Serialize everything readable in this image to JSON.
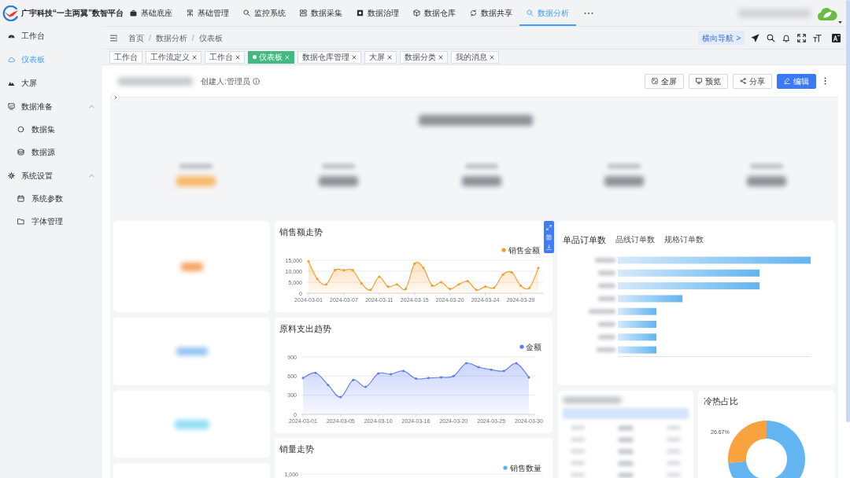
{
  "header": {
    "logo_text": "广宇科技“一主两翼”数智平台",
    "nav": [
      {
        "label": "基础底座",
        "selected": false
      },
      {
        "label": "基础管理",
        "selected": false
      },
      {
        "label": "监控系统",
        "selected": false
      },
      {
        "label": "数据采集",
        "selected": false
      },
      {
        "label": "数据治理",
        "selected": false
      },
      {
        "label": "数据仓库",
        "selected": false
      },
      {
        "label": "数据共享",
        "selected": false
      },
      {
        "label": "数据分析",
        "selected": true
      }
    ]
  },
  "sidebar": {
    "items": [
      {
        "label": "工作台",
        "selected": false
      },
      {
        "label": "仪表板",
        "selected": true
      },
      {
        "label": "大屏",
        "selected": false
      },
      {
        "label": "数据准备",
        "selected": false,
        "expanded": true,
        "children": [
          {
            "label": "数据集",
            "selected": false
          },
          {
            "label": "数据源",
            "selected": false
          }
        ]
      },
      {
        "label": "系统设置",
        "selected": false,
        "expanded": true,
        "children": [
          {
            "label": "系统参数",
            "selected": false
          },
          {
            "label": "字体管理",
            "selected": false
          }
        ]
      }
    ]
  },
  "toolbar": {
    "breadcrumb": [
      "首页",
      "数据分析",
      "仪表板"
    ],
    "separators": [
      "/",
      "/"
    ],
    "nav_button": "横向导航 >"
  },
  "tags": [
    {
      "label": "工作台",
      "closable": false,
      "selected": false
    },
    {
      "label": "工作流定义",
      "closable": true,
      "selected": false
    },
    {
      "label": "工作台",
      "closable": true,
      "selected": false
    },
    {
      "label": "仪表板",
      "closable": true,
      "selected": true
    },
    {
      "label": "数据仓库管理",
      "closable": true,
      "selected": false
    },
    {
      "label": "大屏",
      "closable": true,
      "selected": false
    },
    {
      "label": "数据分类",
      "closable": true,
      "selected": false
    },
    {
      "label": "我的消息",
      "closable": true,
      "selected": false
    }
  ],
  "dashboard": {
    "creator": "创建人:管理员",
    "actions": [
      {
        "label": "全屏",
        "primary": false
      },
      {
        "label": "预览",
        "primary": false
      },
      {
        "label": "分享",
        "primary": false
      },
      {
        "label": "编辑",
        "primary": true
      }
    ]
  },
  "sales_chart": {
    "title": "销售额走势",
    "chart_data": {
      "type": "area",
      "categories": [
        "2024-03-01",
        null,
        null,
        null,
        "2024-03-07",
        null,
        null,
        null,
        "2024-03-11",
        null,
        null,
        null,
        "2024-03-15",
        null,
        null,
        null,
        "2024-03-20",
        null,
        null,
        null,
        "2024-03-24",
        null,
        null,
        null,
        "2024-03-29",
        null,
        null
      ],
      "ylim": [
        0,
        15000
      ],
      "yticks": [
        {
          "value": 0,
          "label": "0"
        },
        {
          "value": 5000,
          "label": "5,000"
        },
        {
          "value": 10000,
          "label": "10,000"
        },
        {
          "value": 15000,
          "label": "15,000"
        }
      ],
      "series": [
        {
          "name": "销售金额",
          "color": "#f59a23",
          "values": [
            14500,
            6500,
            4000,
            10500,
            10500,
            10500,
            4500,
            1500,
            7500,
            3000,
            4000,
            2000,
            13500,
            11500,
            3500,
            5000,
            2000,
            4000,
            5500,
            1500,
            3000,
            2500,
            8500,
            9500,
            3500,
            2500,
            11500
          ]
        }
      ]
    }
  },
  "material_chart": {
    "title": "原料支出趋势",
    "chart_data": {
      "type": "area",
      "categories": [
        "2024-03-01",
        null,
        null,
        "2024-03-05",
        null,
        null,
        "2024-03-10",
        null,
        null,
        "2024-03-16",
        null,
        null,
        "2024-03-20",
        null,
        null,
        "2024-03-25",
        null,
        null,
        "2024-03-30"
      ],
      "ylim": [
        0,
        900
      ],
      "yticks": [
        0,
        300,
        600,
        900
      ],
      "series": [
        {
          "name": "金额",
          "color": "#5b7bf6",
          "values": [
            570,
            650,
            460,
            270,
            540,
            430,
            640,
            630,
            680,
            560,
            570,
            580,
            600,
            800,
            740,
            700,
            680,
            800,
            580
          ]
        }
      ]
    }
  },
  "volume_chart": {
    "title": "销量走势",
    "legend": "销售数量",
    "axis_label": "1,000"
  },
  "order_chart": {
    "tabs": [
      {
        "label": "单品订单数",
        "selected": true
      },
      {
        "label": "品线订单数",
        "selected": false
      },
      {
        "label": "规格订单数",
        "selected": false
      }
    ]
  },
  "hot_cold_chart": {
    "title": "冷热占比",
    "slice_label": "26.67%"
  }
}
